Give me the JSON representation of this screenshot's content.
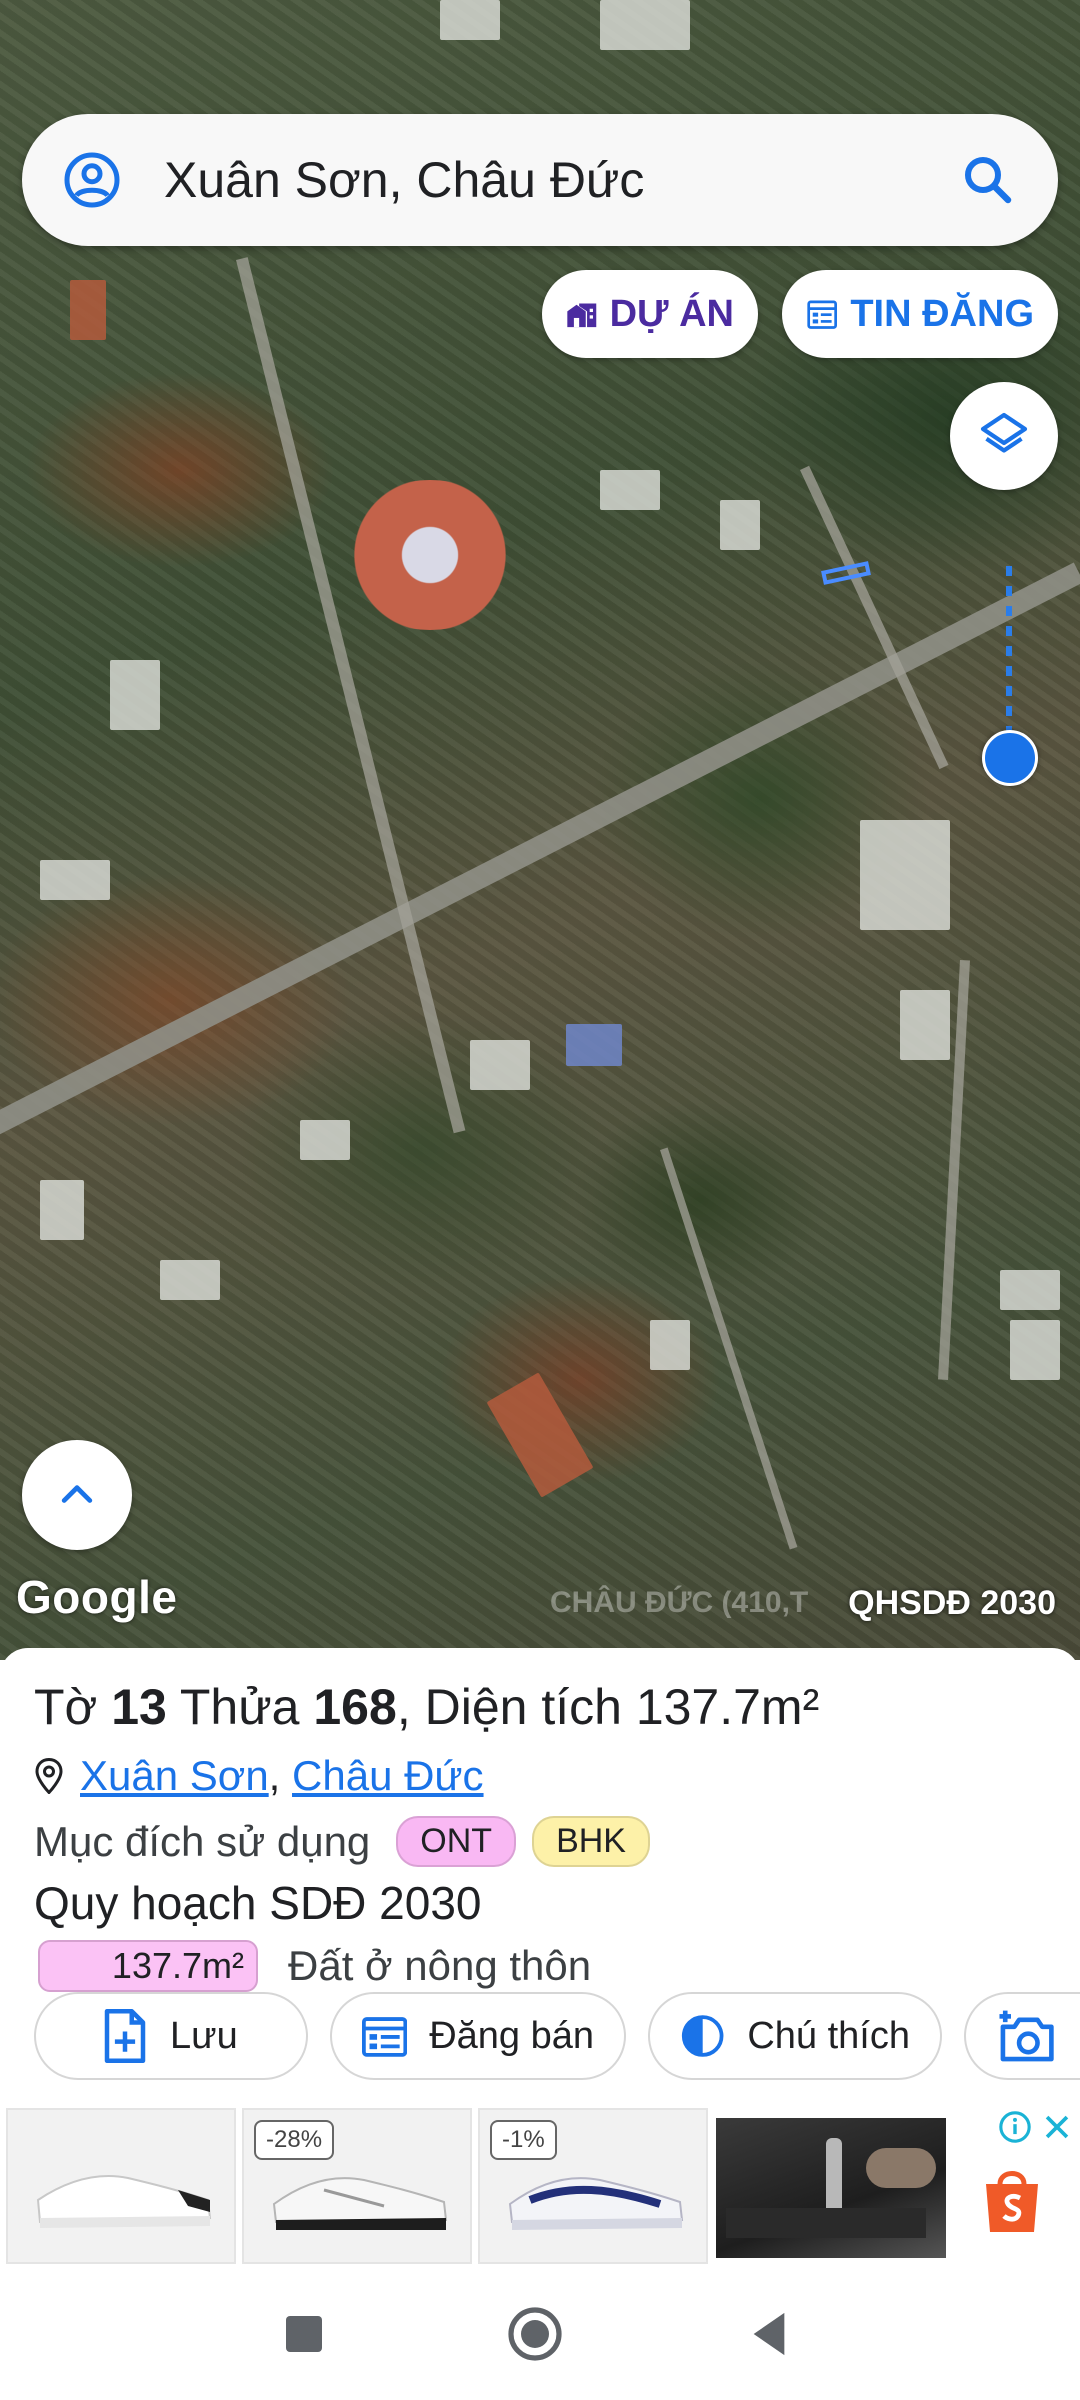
{
  "search": {
    "query": "Xuân Sơn, Châu Đức"
  },
  "chips": {
    "du_an": "DỰ ÁN",
    "tin_dang": "TIN ĐĂNG"
  },
  "map": {
    "attribution": "Google",
    "watermark": "CHÂU ĐỨC (410,T",
    "planning_layer": "QHSDĐ 2030"
  },
  "parcel": {
    "sheet_prefix": "Tờ ",
    "sheet_no": "13",
    "plot_prefix": " Thửa ",
    "plot_no": "168",
    "area_prefix": ", Diện tích ",
    "area": "137.7m²",
    "commune": "Xuân Sơn",
    "separator": ",",
    "district": "Châu Đức",
    "usage_label": "Mục đích sử dụng",
    "usage_codes": [
      "ONT",
      "BHK"
    ],
    "planning_title": "Quy hoạch SDĐ 2030",
    "planning_area": "137.7m²",
    "planning_land_type": "Đất ở nông thôn"
  },
  "actions": {
    "save": "Lưu",
    "post": "Đăng bán",
    "legend": "Chú thích"
  },
  "ads": {
    "discounts": [
      "-28%",
      "-1%"
    ]
  },
  "colors": {
    "accent_blue": "#1a73e8",
    "purple": "#4b2ba0",
    "ont_badge": "#f9b8f3",
    "bhk_badge": "#fdf1a8"
  }
}
